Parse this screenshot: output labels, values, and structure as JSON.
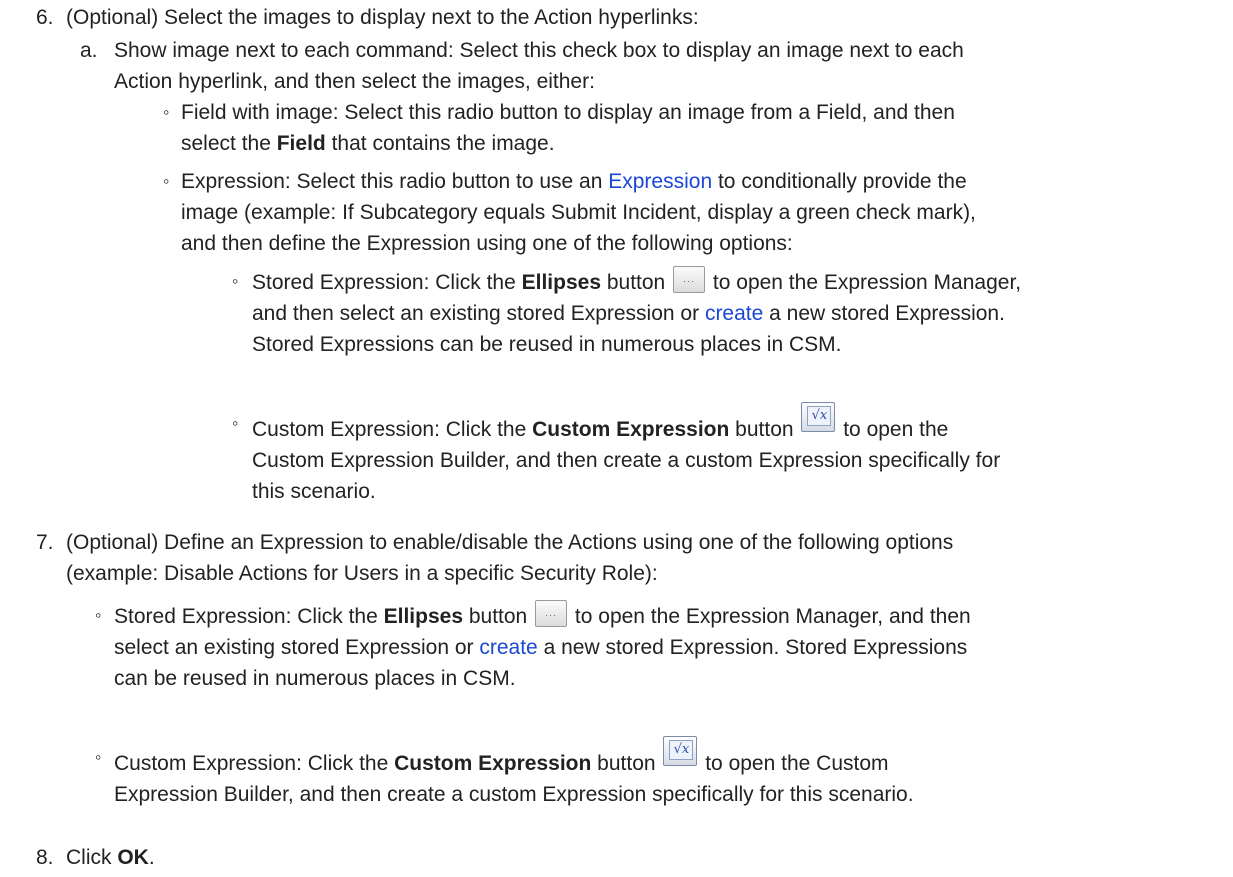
{
  "step6": {
    "num": "6.",
    "text": "(Optional) Select the images to display next to the Action hyperlinks:",
    "a": {
      "num": "a.",
      "line1": "Show image next to each command: Select this check box to display an image next to each",
      "line2": "Action hyperlink, and then select the images, either:"
    },
    "field": {
      "line1": "Field with image: Select this radio button to display an image from a Field, and then",
      "line2_pre": "select the ",
      "line2_bold": "Field",
      "line2_post": " that contains the image."
    },
    "expr": {
      "line1_pre": "Expression: Select this radio button to use an ",
      "line1_link": "Expression",
      "line1_post": " to conditionally provide the",
      "line2": "image (example: If Subcategory equals Submit Incident, display a green check mark),",
      "line3": "and then define the Expression using one of the following options:"
    },
    "stored": {
      "line1_pre": "Stored Expression: Click the ",
      "line1_bold": "Ellipses",
      "line1_mid": " button ",
      "line1_post": " to open the Expression Manager,",
      "line2_pre": "and then select an existing stored Expression or ",
      "line2_link": "create",
      "line2_post": " a new stored Expression.",
      "line3": "Stored Expressions can be reused in numerous places in CSM."
    },
    "custom": {
      "line1_pre": "Custom Expression: Click the ",
      "line1_bold": "Custom Expression",
      "line1_mid": " button ",
      "line1_post": " to open the",
      "line2": "Custom Expression Builder, and then create a custom Expression specifically for",
      "line3": "this scenario."
    }
  },
  "step7": {
    "num": "7.",
    "line1": "(Optional) Define an Expression to enable/disable the Actions using one of the following options",
    "line2": "(example: Disable Actions for Users in a specific Security Role):",
    "stored": {
      "line1_pre": "Stored Expression: Click the ",
      "line1_bold": "Ellipses",
      "line1_mid": " button ",
      "line1_post": " to open the Expression Manager, and then",
      "line2_pre": "select an existing stored Expression or ",
      "line2_link": "create",
      "line2_post": " a new stored Expression. Stored Expressions",
      "line3": "can be reused in numerous places in CSM."
    },
    "custom": {
      "line1_pre": "Custom Expression: Click the ",
      "line1_bold": "Custom Expression",
      "line1_mid": " button ",
      "line1_post": " to open the Custom",
      "line2": "Expression Builder, and then create a custom Expression specifically for this scenario."
    }
  },
  "step8": {
    "num": "8.",
    "pre": "Click ",
    "bold": "OK",
    "post": "."
  },
  "icons": {
    "bullet": "◦",
    "ellipses_glyph": "···",
    "fx_glyph": "√x"
  }
}
